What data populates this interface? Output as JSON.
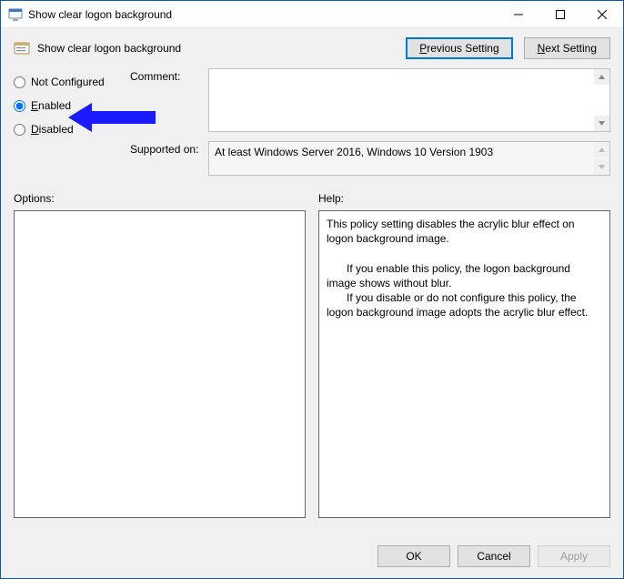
{
  "window": {
    "title": "Show clear logon background",
    "header_title": "Show clear logon background"
  },
  "nav": {
    "previous": "Previous Setting",
    "next": "Next Setting"
  },
  "radios": {
    "not_configured": "ot Configured",
    "enabled": "nabled",
    "disabled": "isabled",
    "selected": "enabled"
  },
  "fields": {
    "comment_label": "Comment:",
    "comment_value": "",
    "supported_label": "Supported on:",
    "supported_value": "At least Windows Server 2016, Windows 10 Version 1903"
  },
  "columns": {
    "options_label": "Options:",
    "help_label": "Help:"
  },
  "help": {
    "p1": "This policy setting disables the acrylic blur effect on logon background image.",
    "p2": "If you enable this policy, the logon background image shows without blur.",
    "p3": "If you disable or do not configure this policy, the logon background image adopts the acrylic blur effect."
  },
  "footer": {
    "ok": "OK",
    "cancel": "Cancel",
    "apply": "Apply"
  },
  "annotation": {
    "color": "#1a1aff"
  }
}
